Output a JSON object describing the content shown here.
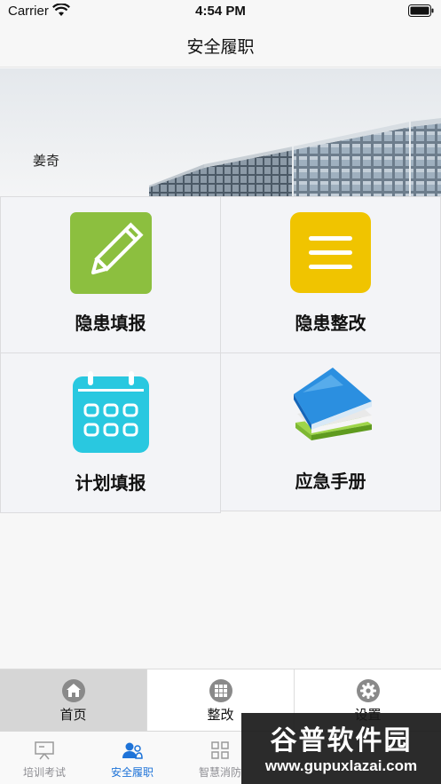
{
  "status_bar": {
    "carrier": "Carrier",
    "time": "4:54 PM"
  },
  "nav": {
    "title": "安全履职"
  },
  "banner": {
    "user_name": "姜奇"
  },
  "grid": {
    "items": [
      {
        "label": "隐患填报",
        "icon": "pencil-icon",
        "color": "#8cbf3f"
      },
      {
        "label": "隐患整改",
        "icon": "list-icon",
        "color": "#f0c400"
      },
      {
        "label": "计划填报",
        "icon": "calendar-icon",
        "color": "#29c8e0"
      },
      {
        "label": "应急手册",
        "icon": "books-icon",
        "color": "#1e88d8"
      }
    ]
  },
  "top_tabs": {
    "items": [
      {
        "label": "首页",
        "icon": "home-icon",
        "selected": true
      },
      {
        "label": "整改",
        "icon": "grid-icon"
      },
      {
        "label": "设置",
        "icon": "gear-icon"
      }
    ]
  },
  "bottom_tabs": {
    "items": [
      {
        "label": "培训考试",
        "icon": "presentation-board-icon"
      },
      {
        "label": "安全履职",
        "icon": "user-group-icon",
        "active": true
      },
      {
        "label": "智慧消防",
        "icon": "apps-icon"
      }
    ],
    "active_color": "#1e73d8",
    "inactive_color": "#8e8e93"
  },
  "watermark": {
    "title": "谷普软件园",
    "url": "www.gupuxlazai.com"
  }
}
